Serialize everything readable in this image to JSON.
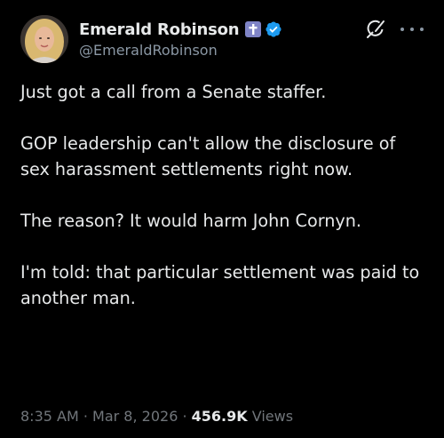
{
  "author": {
    "display_name": "Emerald Robinson",
    "handle": "@EmeraldRobinson",
    "avatar": "avatar",
    "badges": [
      "cross-icon",
      "verified-icon"
    ],
    "verified_color": "#1d9bf0",
    "cross_badge_color": "#7f84c6"
  },
  "header_actions": {
    "grok_icon": "grok-icon",
    "more_icon": "more-icon"
  },
  "tweet": {
    "paragraphs": [
      "Just got a call from a Senate staffer.",
      "GOP leadership can't allow the disclosure of sex harassment settlements right now.",
      "The reason? It would harm John Cornyn.",
      "I'm told: that particular settlement was paid to another man."
    ]
  },
  "meta": {
    "time": "8:35 AM",
    "separator": " · ",
    "date": "Mar 8, 2026",
    "views_count": "456.9K",
    "views_label": " Views"
  }
}
